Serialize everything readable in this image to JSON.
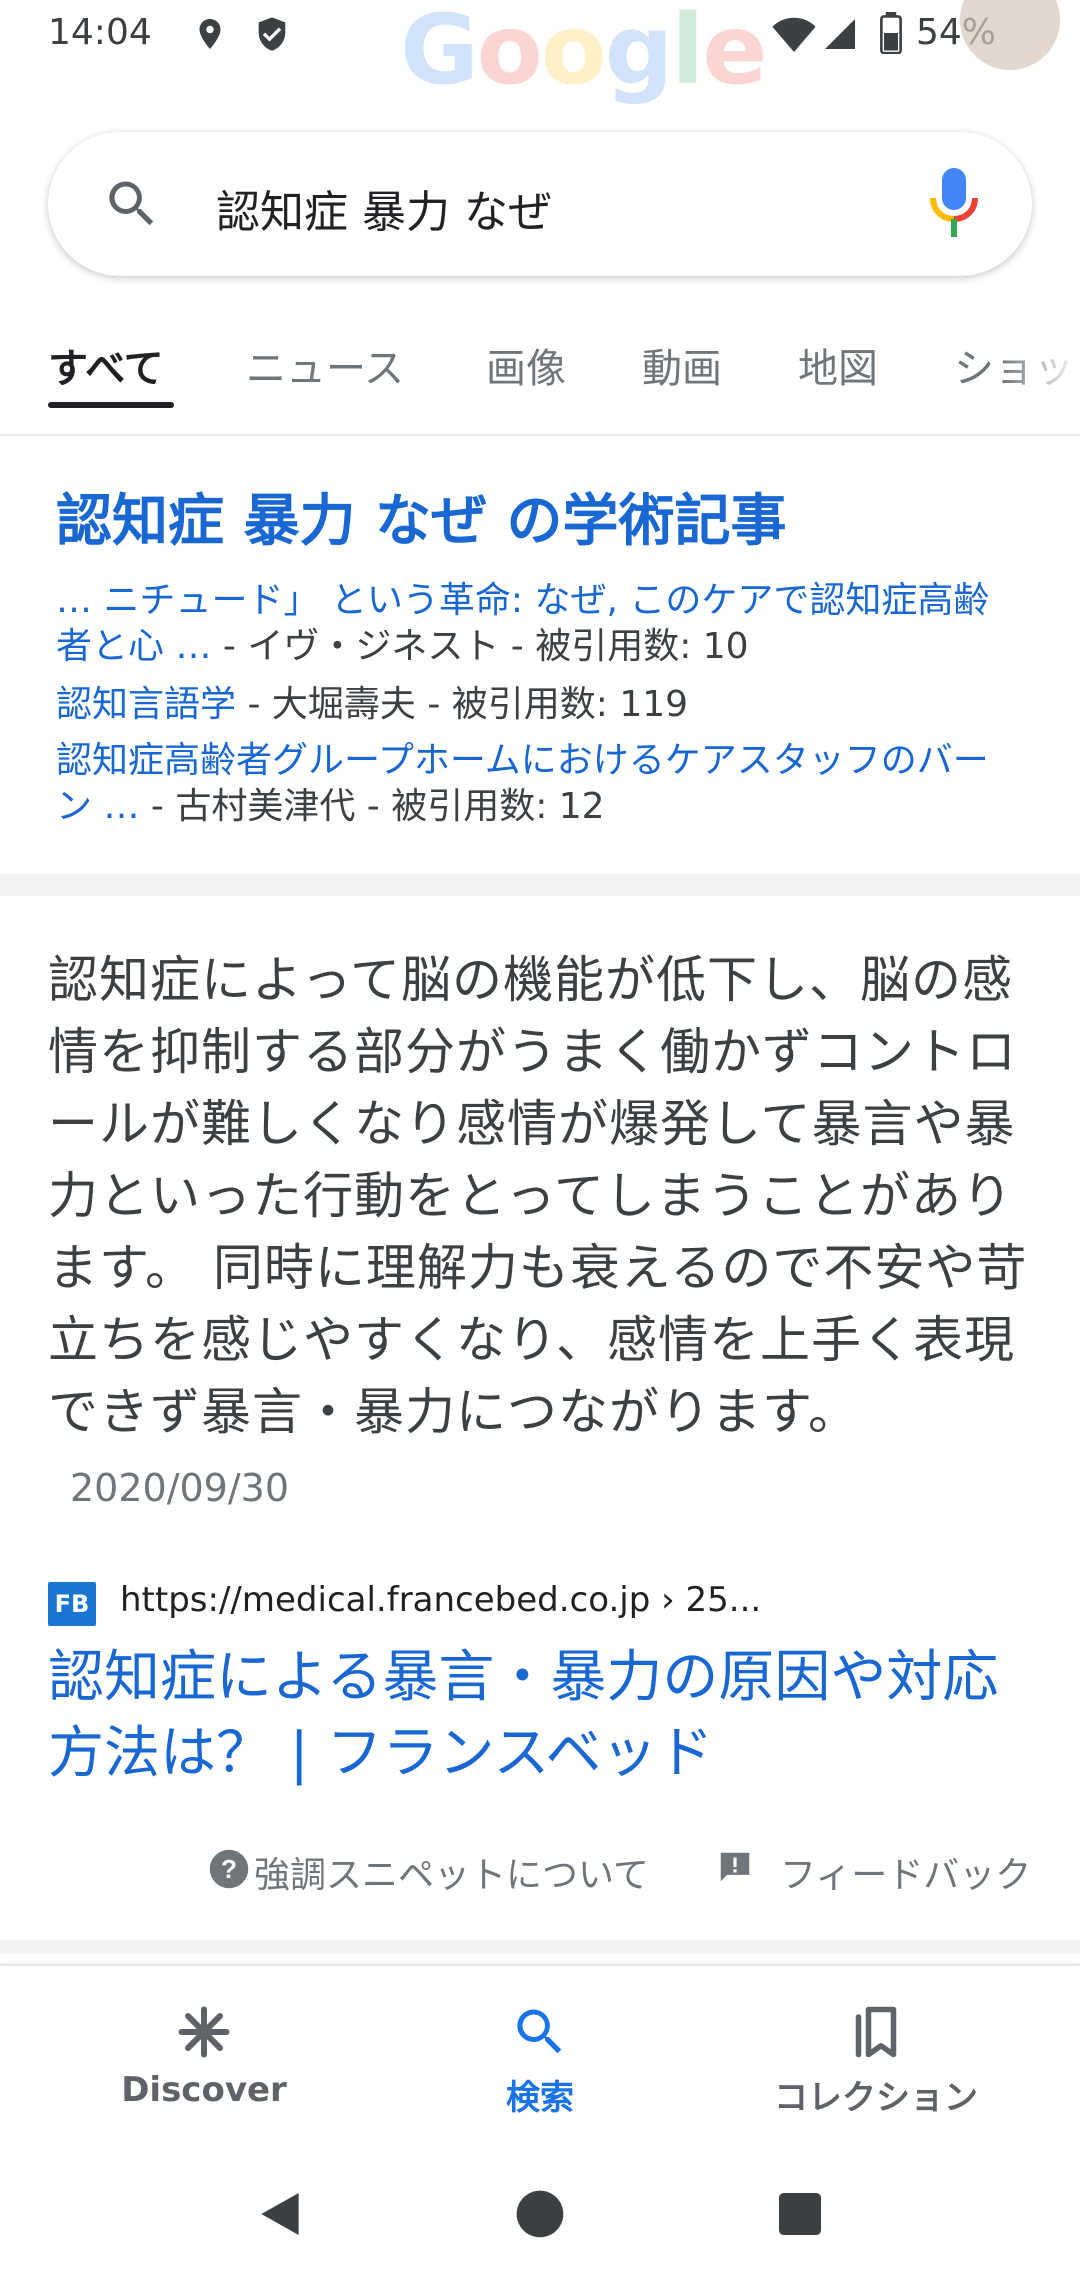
{
  "status_bar": {
    "time": "14:04",
    "battery": "54%",
    "logo_letters": [
      "G",
      "o",
      "o",
      "g",
      "l",
      "e"
    ]
  },
  "search": {
    "query": "認知症 暴力 なぜ"
  },
  "tabs": [
    "すべて",
    "ニュース",
    "画像",
    "動画",
    "地図",
    "ショッ"
  ],
  "scholar": {
    "title": "認知症 暴力 なぜ の学術記事",
    "items": [
      {
        "link": "… ニチュード」 という革命: なぜ, このケアで認知症高齢者と心 …",
        "meta": " - イヴ・ジネスト - 被引用数: 10"
      },
      {
        "link": "認知言語学",
        "meta": " - 大堀壽夫 - 被引用数: 119"
      },
      {
        "link": "認知症高齢者グループホームにおけるケアスタッフのバーン …",
        "meta": " - 古村美津代 - 被引用数: 12"
      }
    ]
  },
  "snippet": {
    "text": "認知症によって脳の機能が低下し、脳の感情を抑制する部分がうまく働かずコントロールが難しくなり感情が爆発して暴言や暴力といった行動をとってしまうことがあります。 同時に理解力も衰えるので不安や苛立ちを感じやすくなり、感情を上手く表現できず暴言・暴力につながります。",
    "date": "2020/09/30",
    "source_icon_text": "FB",
    "source_url": "https://medical.francebed.co.jp › 25...",
    "result_title": "認知症による暴言・暴力の原因や対応方法は？ | フランスベッド",
    "about_label": "強調スニペットについて",
    "feedback_label": "フィードバック"
  },
  "bottom_nav": {
    "discover": "Discover",
    "search": "検索",
    "collections": "コレクション"
  },
  "colors": {
    "link": "#1967d2",
    "active_nav": "#1a73e8",
    "text": "#3c4043"
  }
}
